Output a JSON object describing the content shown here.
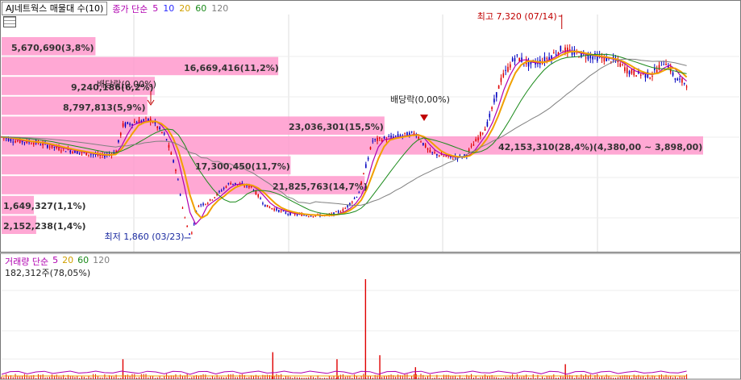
{
  "header": {
    "title": "AJ네트웍스 매물대 수(10)",
    "ma_label": "종가 단순",
    "ma_periods": [
      "5",
      "10",
      "20",
      "60",
      "120"
    ]
  },
  "volume_header": {
    "label": "거래량 단순",
    "periods": [
      "5",
      "20",
      "60",
      "120"
    ],
    "info": "182,312주(78,05%)"
  },
  "colors": {
    "candle_up": "#e00000",
    "candle_down": "#0000c0",
    "ma5": "#b000b0",
    "ma10": "#2a2aff",
    "ma20": "#f0a000",
    "ma60": "#1a8a1a",
    "ma120": "#808080",
    "profile_bar": "#ff99cc"
  },
  "chart_data": {
    "type": "volume_profile_candlestick",
    "price_annotations": {
      "high": "최고 7,320 (07/14)",
      "low": "최저 1,860 (03/23)",
      "dividend_1": "배당락(0,00%)",
      "dividend_2": "배당락(0,00%)"
    },
    "volume_profile": [
      {
        "label": "5,670,690(3,8%)",
        "pct": 3.8
      },
      {
        "label": "16,669,416(11,2%)",
        "pct": 11.2
      },
      {
        "label": "9,240,186(6,2%)",
        "pct": 6.2
      },
      {
        "label": "8,797,813(5,9%)",
        "pct": 5.9
      },
      {
        "label": "23,036,301(15,5%)",
        "pct": 15.5
      },
      {
        "label": "42,153,310(28,4%)(4,380,00 ~ 3,898,00)",
        "pct": 28.4
      },
      {
        "label": "17,300,450(11,7%)",
        "pct": 11.7
      },
      {
        "label": "21,825,763(14,7%)",
        "pct": 14.7
      },
      {
        "label": "1,649,327(1,1%)",
        "pct": 1.1
      },
      {
        "label": "2,152,238(1,4%)",
        "pct": 1.4
      }
    ],
    "price_series": [
      [
        0,
        4500
      ],
      [
        0.02,
        4400
      ],
      [
        0.05,
        4350
      ],
      [
        0.08,
        4200
      ],
      [
        0.11,
        4100
      ],
      [
        0.14,
        4000
      ],
      [
        0.16,
        4100
      ],
      [
        0.17,
        4800
      ],
      [
        0.19,
        4900
      ],
      [
        0.21,
        4950
      ],
      [
        0.23,
        4500
      ],
      [
        0.245,
        3600
      ],
      [
        0.255,
        2500
      ],
      [
        0.265,
        1860
      ],
      [
        0.275,
        2700
      ],
      [
        0.29,
        2800
      ],
      [
        0.32,
        3300
      ],
      [
        0.35,
        3200
      ],
      [
        0.37,
        2700
      ],
      [
        0.4,
        2500
      ],
      [
        0.43,
        2450
      ],
      [
        0.46,
        2450
      ],
      [
        0.48,
        2600
      ],
      [
        0.5,
        3000
      ],
      [
        0.52,
        4400
      ],
      [
        0.55,
        4500
      ],
      [
        0.58,
        4600
      ],
      [
        0.6,
        4100
      ],
      [
        0.63,
        3950
      ],
      [
        0.65,
        4000
      ],
      [
        0.68,
        4800
      ],
      [
        0.7,
        6000
      ],
      [
        0.72,
        6600
      ],
      [
        0.74,
        6400
      ],
      [
        0.76,
        6500
      ],
      [
        0.785,
        6800
      ],
      [
        0.8,
        6700
      ],
      [
        0.83,
        6600
      ],
      [
        0.86,
        6500
      ],
      [
        0.88,
        6200
      ],
      [
        0.91,
        6100
      ],
      [
        0.93,
        6500
      ],
      [
        0.945,
        6000
      ],
      [
        0.96,
        5900
      ]
    ],
    "price_range": [
      1500,
      7700
    ],
    "volume_spikes": [
      {
        "x": 0.17,
        "v": 0.2
      },
      {
        "x": 0.38,
        "v": 0.27
      },
      {
        "x": 0.47,
        "v": 0.2
      },
      {
        "x": 0.51,
        "v": 1.0
      },
      {
        "x": 0.53,
        "v": 0.24
      },
      {
        "x": 0.58,
        "v": 0.12
      },
      {
        "x": 0.79,
        "v": 0.15
      }
    ]
  }
}
